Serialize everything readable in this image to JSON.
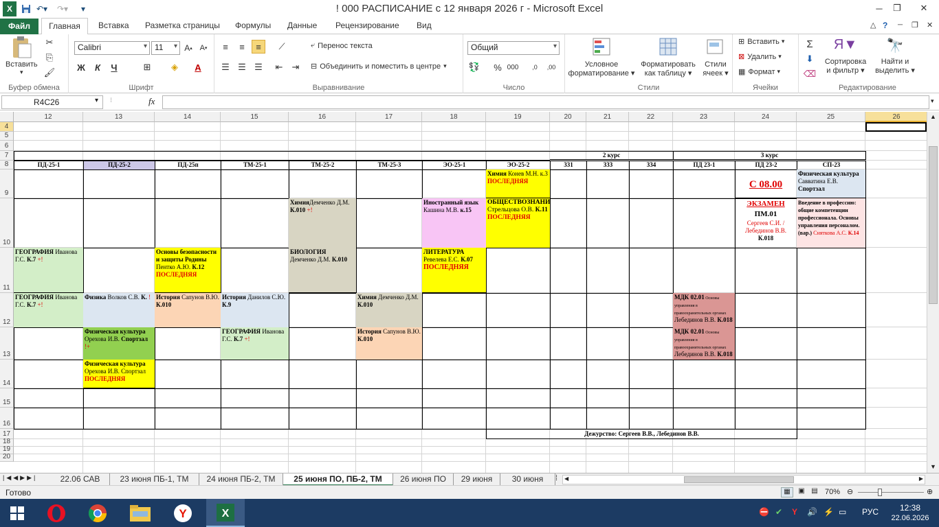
{
  "window": {
    "title": "! 000 РАСПИСАНИЕ с 12 января 2026 г  -  Microsoft Excel"
  },
  "ribbon_tabs": [
    "Файл",
    "Главная",
    "Вставка",
    "Разметка страницы",
    "Формулы",
    "Данные",
    "Рецензирование",
    "Вид"
  ],
  "ribbon": {
    "paste": "Вставить",
    "clipboard": "Буфер обмена",
    "font_name": "Calibri",
    "font_size": "11",
    "font_group": "Шрифт",
    "bold": "Ж",
    "italic": "К",
    "underline": "Ч",
    "wrap": "Перенос текста",
    "merge": "Объединить и поместить в центре",
    "align_group": "Выравнивание",
    "number_format": "Общий",
    "number_group": "Число",
    "cond_fmt_1": "Условное",
    "cond_fmt_2": "форматирование",
    "fmt_table_1": "Форматировать",
    "fmt_table_2": "как таблицу",
    "styles_1": "Стили",
    "styles_2": "ячеек",
    "styles_group": "Стили",
    "insert": "Вставить",
    "delete": "Удалить",
    "format": "Формат",
    "cells_group": "Ячейки",
    "sort_1": "Сортировка",
    "sort_2": "и фильтр",
    "find_1": "Найти и",
    "find_2": "выделить",
    "edit_group": "Редактирование"
  },
  "formula": {
    "name_box": "R4C26",
    "fx": "fx",
    "content": ""
  },
  "columns": [
    "12",
    "13",
    "14",
    "15",
    "16",
    "17",
    "18",
    "19",
    "20",
    "21",
    "22",
    "23",
    "24",
    "25",
    "26"
  ],
  "rows": [
    "4",
    "5",
    "6",
    "7",
    "8",
    "9",
    "10",
    "11",
    "12",
    "13",
    "14",
    "15",
    "16",
    "17",
    "18",
    "19",
    "20"
  ],
  "course_headers": {
    "c2": "2 курс",
    "c3": "3 курс"
  },
  "groups": [
    "ПД-25-1",
    "ПД-25-2",
    "ПД-25п",
    "ТМ-25-1",
    "ТМ-25-2",
    "ТМ-25-3",
    "ЭО-25-1",
    "ЭО-25-2",
    "331",
    "333",
    "334",
    "ПД 23-1",
    "ПД 23-2",
    "СП-23"
  ],
  "cells": {
    "r9_eo252_a": "Химия",
    "r9_eo252_b": " Конев М.Н. к.3",
    "r9_eo252_c": "ПОСЛЕДНЯЯ",
    "r9_pd232": "С 08.00",
    "r9_sp23_a": "Физическая культура",
    "r9_sp23_b": " Савватина Е.В. ",
    "r9_sp23_c": "Спортзал",
    "r10_tm252_a": "Химия",
    "r10_tm252_b": "Демченко Д.М. ",
    "r10_tm252_c": "К.010",
    "r10_tm252_d": " +!",
    "r10_eo251_a": "Иностранный язык",
    "r10_eo251_b": " Кашина М.В. ",
    "r10_eo251_c": "к.15",
    "r10_eo252_a": "ОБЩЕСТВОЗНАНИЕ",
    "r10_eo252_b": " Стрельцова О.В.",
    "r10_eo252_c": "К.11",
    "r10_eo252_d": "ПОСЛЕДНЯЯ",
    "r10_pd232_a": "ЭКЗАМЕН",
    "r10_pd232_b": "ПМ.01",
    "r10_pd232_c": "Сергеев С.И. /Лебединов В.В.",
    "r10_pd232_d": "К.018",
    "r10_sp23_a": "Введение в профессию: общие компетенции профессионала. Основы управления персоналом. (вар.)",
    "r10_sp23_b": " Сняткова А.С.",
    "r10_sp23_c": " К.14",
    "r11_pd251_a": "ГЕОГРАФИЯ",
    "r11_pd251_b": " Иванова Г.С. ",
    "r11_pd251_c": "К.7",
    "r11_pd251_d": " +!",
    "r11_pd25p_a": "Основы безопасности и защиты Родины",
    "r11_pd25p_b": " Пентко А.Ю. ",
    "r11_pd25p_c": "К.12",
    "r11_pd25p_d": "ПОСЛЕДНЯЯ",
    "r11_tm252_a": "БИОЛОГИЯ",
    "r11_tm252_b": " Демченко Д.М. ",
    "r11_tm252_c": "К.010",
    "r11_eo251_a": "ЛИТЕРАТУРА",
    "r11_eo251_b": " Ревелева Е.С. ",
    "r11_eo251_c": "К.07",
    "r11_eo251_d": "ПОСЛЕДНЯЯ",
    "r12_pd251_a": "ГЕОГРАФИЯ",
    "r12_pd251_b": " Иванова Г.С. ",
    "r12_pd251_c": "К.7",
    "r12_pd251_d": " +!",
    "r12_pd252_a": "Физика",
    "r12_pd252_b": "   Волков С.В. ",
    "r12_pd252_c": "К.",
    "r12_pd252_d": " !",
    "r12_pd25p_a": "История",
    "r12_pd25p_b": " Сапунов В.Ю. ",
    "r12_pd25p_c": "К.010",
    "r12_tm251_a": "История",
    "r12_tm251_b": " Данилов С.Ю. ",
    "r12_tm251_c": "К.9",
    "r12_tm253_a": "Химия",
    "r12_tm253_b": " Демченко Д.М. ",
    "r12_tm253_c": "К.010",
    "r12_pd231_a": "МДК 02.01",
    "r12_pd231_b": " Основы управления в правоохранительных органах",
    "r12_pd231_c": " Лебединов В.В. ",
    "r12_pd231_d": "К.018",
    "r13_pd252_a": "Физическая культура",
    "r13_pd252_b": " Орехова И.В. ",
    "r13_pd252_c": "Спортзал",
    "r13_pd252_d": " !+",
    "r13_tm251_a": "ГЕОГРАФИЯ",
    "r13_tm251_b": " Иванова Г.С. ",
    "r13_tm251_c": "К.7",
    "r13_tm251_d": " +!",
    "r13_tm253_a": "История",
    "r13_tm253_b": " Сапунов В.Ю. ",
    "r13_tm253_c": "К.010",
    "r13_pd231_a": "МДК 02.01",
    "r13_pd231_b": " Основы управления в правоохранительных органах",
    "r13_pd231_c": " Лебединов В.В. ",
    "r13_pd231_d": "К.018",
    "r14_pd252_a": "Физическая культура",
    "r14_pd252_b": " Орехова И.В. Спортзал ",
    "r14_pd252_c": "ПОСЛЕДНЯЯ",
    "r17_duty": "Дежурство: Сергеев В.В., Лебединов В.В."
  },
  "sheet_tabs": [
    "22.06 САВ",
    "23 июня ПБ-1, ТМ",
    "24 июня ПБ-2, ТМ",
    "25 июня ПО, ПБ-2, ТМ",
    "26 июня ПО",
    "29 июня",
    "30 июня"
  ],
  "status": {
    "ready": "Готово",
    "zoom": "70%"
  },
  "taskbar": {
    "lang": "РУС",
    "time": "12:38",
    "date": "22.06.2026"
  },
  "colors": {
    "green": "#d3eec8",
    "gray": "#d8d5c3",
    "pink": "#f8c5f5",
    "yellow": "#ffff00",
    "blue": "#dce6f1",
    "peach": "#fcd5b5",
    "rose": "#fde4e4",
    "mdk": "#da9694",
    "lime": "#92d050",
    "lavender": "#cdc8e8"
  }
}
